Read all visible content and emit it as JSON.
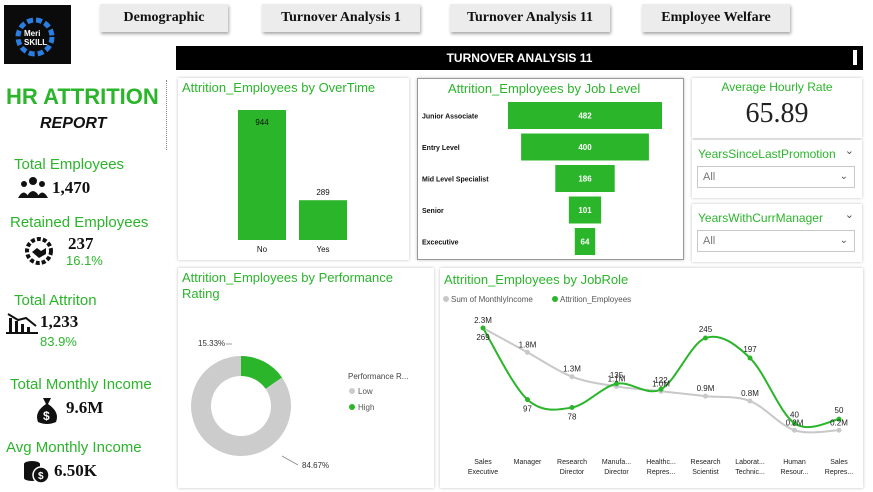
{
  "logo": {
    "line1": "Meri",
    "line2": "SKILL"
  },
  "nav": {
    "demographic": "Demographic",
    "turnover1": "Turnover Analysis 1",
    "turnover11": "Turnover Analysis 11",
    "welfare": "Employee Welfare"
  },
  "page_title": "TURNOVER ANALYSIS 11",
  "report": {
    "title": "HR ATTRITION",
    "subtitle": "REPORT"
  },
  "kpis": {
    "total_employees": {
      "label": "Total Employees",
      "value": "1,470",
      "icon": "people-icon"
    },
    "retained": {
      "label": "Retained Employees",
      "value": "237",
      "pct": "16.1%",
      "icon": "handshake-gear-icon"
    },
    "attrition": {
      "label": "Total Attriton",
      "value": "1,233",
      "pct": "83.9%",
      "icon": "declining-chart-icon"
    },
    "monthly_income": {
      "label": "Total Monthly Income",
      "value": "9.6M",
      "icon": "money-bag-icon"
    },
    "avg_income": {
      "label": "Avg Monthly Income",
      "value": "6.50K",
      "icon": "coins-icon"
    }
  },
  "avg_hourly": {
    "label": "Average Hourly Rate",
    "value": "65.89"
  },
  "slicers": {
    "promotion": {
      "label": "YearsSinceLastPromotion",
      "value": "All"
    },
    "manager": {
      "label": "YearsWithCurrManager",
      "value": "All"
    }
  },
  "colors": {
    "green": "#2bb52b",
    "grey": "#c8c8c8",
    "dark": "#111111"
  },
  "chart_data": [
    {
      "type": "bar",
      "title": "Attrition_Employees by OverTime",
      "categories": [
        "No",
        "Yes"
      ],
      "values": [
        944,
        289
      ],
      "value_labels": [
        "944",
        "289"
      ]
    },
    {
      "type": "bar",
      "orientation": "horizontal-funnel",
      "title": "Attrition_Employees by Job Level",
      "categories": [
        "Junior Associate",
        "Entry Level",
        "Mid Level Specialist",
        "Senior",
        "Excecutive"
      ],
      "values": [
        482,
        400,
        186,
        101,
        64
      ],
      "value_labels": [
        "482",
        "400",
        "186",
        "101",
        "64"
      ]
    },
    {
      "type": "pie",
      "style": "donut",
      "title_line1": "Attrition_Employees by Performance",
      "title_line2": "Rating",
      "legend_title": "Performance R...",
      "legend_placement": "right",
      "series": [
        {
          "name": "Low",
          "pct": 84.67,
          "label": "84.67%",
          "color": "#cccccc"
        },
        {
          "name": "High",
          "pct": 15.33,
          "label": "15.33%",
          "color": "#2bb52b"
        }
      ]
    },
    {
      "type": "line",
      "title": "Attrition_Employees by JobRole",
      "legend_placement": "top-left",
      "categories": [
        [
          "Sales",
          "Executive"
        ],
        [
          "Manager"
        ],
        [
          "Research",
          "Director"
        ],
        [
          "Manufa...",
          "Director"
        ],
        [
          "Healthc...",
          "Repres..."
        ],
        [
          "Research",
          "Scientist"
        ],
        [
          "Laborat...",
          "Technic..."
        ],
        [
          "Human",
          "Resour..."
        ],
        [
          "Sales",
          "Repres..."
        ]
      ],
      "series": [
        {
          "name": "Sum of MonthlyIncome",
          "color": "#c8c8c8",
          "values": [
            2.3,
            1.8,
            1.3,
            1.1,
            1.0,
            0.9,
            0.8,
            0.2,
            0.2
          ],
          "labels": [
            "2.3M",
            "1.8M",
            "1.3M",
            "1.1M",
            "1.0M",
            "0.9M",
            "0.8M",
            "0.2M",
            "0.2M"
          ]
        },
        {
          "name": "Attrition_Employees",
          "color": "#2bb52b",
          "values": [
            269,
            97,
            78,
            135,
            122,
            245,
            197,
            40,
            50
          ],
          "labels": [
            "269",
            "97",
            "78",
            "135",
            "122",
            "245",
            "197",
            "40",
            "50"
          ]
        }
      ]
    }
  ]
}
